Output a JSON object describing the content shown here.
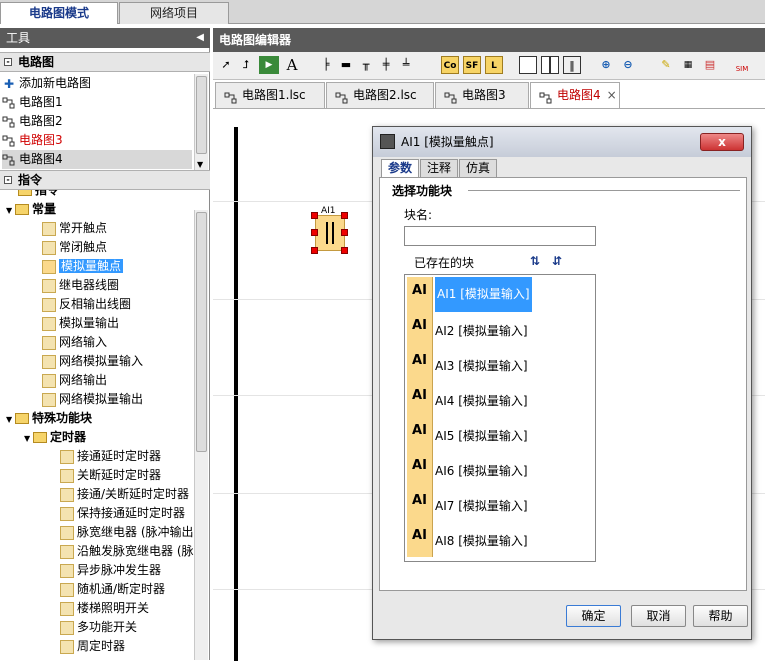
{
  "top_tabs": [
    "电路图模式",
    "网络项目"
  ],
  "tools_panel": {
    "title": "工具"
  },
  "circuit_section": {
    "title": "电路图",
    "items": [
      "添加新电路图",
      "电路图1",
      "电路图2",
      "电路图3",
      "电路图4"
    ]
  },
  "instructions_section": {
    "title": "指令",
    "partial_label": "指令",
    "group_const": "常量",
    "const_items": [
      "常开触点",
      "常闭触点",
      "模拟量触点",
      "继电器线圈",
      "反相输出线圈",
      "模拟量输出",
      "网络输入",
      "网络模拟量输入",
      "网络输出",
      "网络模拟量输出"
    ],
    "group_special": "特殊功能块",
    "group_timer": "定时器",
    "timer_items": [
      "接通延时定时器",
      "关断延时定时器",
      "接通/关断延时定时器",
      "保持接通延时定时器",
      "脉宽继电器 (脉冲输出",
      "沿触发脉宽继电器 (脉",
      "异步脉冲发生器",
      "随机通/断定时器",
      "楼梯照明开关",
      "多功能开关",
      "周定时器"
    ]
  },
  "editor": {
    "title": "电路图编辑器",
    "tabs": [
      "电路图1.lsc",
      "电路图2.lsc",
      "电路图3",
      "电路图4"
    ],
    "close": "×"
  },
  "toolbar": {
    "text_tool": "A",
    "co": "Co",
    "sf": "SF",
    "l": "L",
    "sim": "SIM"
  },
  "canvas": {
    "element_label": "AI1"
  },
  "dialog": {
    "title": "AI1 [模拟量触点]",
    "close": "x",
    "tabs": [
      "参数",
      "注释",
      "仿真"
    ],
    "group": "选择功能块",
    "name_label": "块名:",
    "name_value": "",
    "existing_label": "已存在的块",
    "icon_text": "AI",
    "blocks": [
      "AI1 [模拟量输入]",
      "AI2 [模拟量输入]",
      "AI3 [模拟量输入]",
      "AI4 [模拟量输入]",
      "AI5 [模拟量输入]",
      "AI6 [模拟量输入]",
      "AI7 [模拟量输入]",
      "AI8 [模拟量输入]"
    ],
    "ok": "确定",
    "cancel": "取消",
    "help": "帮助"
  },
  "colors": {
    "selected": "#3399ff",
    "active_tab_text": "#c00000",
    "red_item": "#d00000",
    "accent_block": "#fbd98c"
  }
}
